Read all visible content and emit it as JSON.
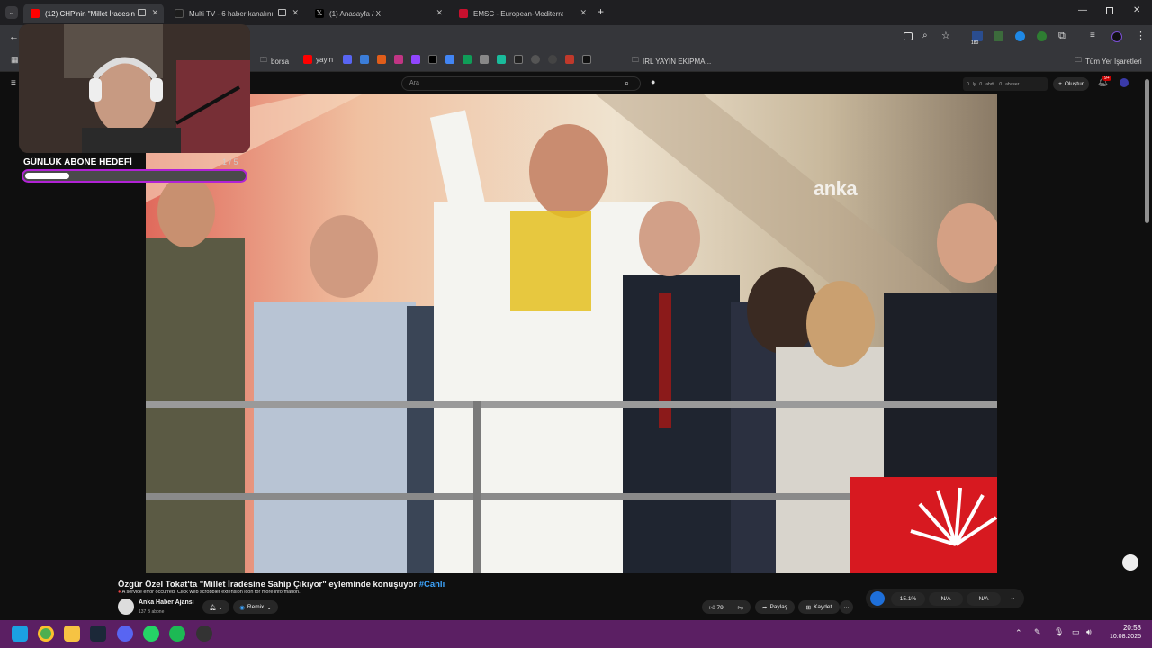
{
  "browser": {
    "tabs": [
      {
        "title": "(12) CHP'nin \"Millet İradesine",
        "active": true,
        "favicon_color": "#ff0000"
      },
      {
        "title": "Multi TV - 6 haber kanalını",
        "active": false,
        "favicon_color": "#1d1d1d"
      },
      {
        "title": "(1) Anasayfa / X",
        "active": false,
        "favicon_color": "#000000"
      },
      {
        "title": "EMSC - European-Mediterranea",
        "active": false,
        "favicon_color": "#c8102e"
      }
    ],
    "bookmarks": [
      {
        "label": "borsa",
        "icon": "folder-icon"
      },
      {
        "label": "yayın",
        "icon": "youtube-icon"
      },
      {
        "label": "IRL YAYIN EKİPMA...",
        "icon": "folder-icon"
      }
    ],
    "all_bookmarks_label": "Tüm Yer İşaretleri",
    "ext_badge": "180"
  },
  "youtube": {
    "search_placeholder": "Ara",
    "create_label": "Oluştur",
    "notif_badge": "9+",
    "stat1": "0",
    "stat1_label": "ly",
    "stat2": "0",
    "stat2_label": "abdt.",
    "stat3": "0",
    "stat3_label": "abuser.",
    "video_watermark": "anka",
    "video_title": "Özgür Özel Tokat'ta \"Millet İradesine Sahip Çıkıyor\" eyleminde konuşuyor",
    "live_tag": "#Canlı",
    "error_text": "A service error occurred. Click web scrobbler extension icon for more information.",
    "channel_name": "Anka Haber Ajansı",
    "channel_subs": "137 B abone",
    "remix_label": "Remix",
    "likes": "79",
    "share_label": "Paylaş",
    "save_label": "Kaydet",
    "sponsor_stats": [
      "15.1%",
      "N/A",
      "N/A"
    ]
  },
  "overlay": {
    "goal_label": "GÜNLÜK ABONE HEDEFİ",
    "goal_count": "1 / 5",
    "goal_progress": 0.2
  },
  "taskbar": {
    "time": "20:58",
    "date": "10.08.2025"
  }
}
